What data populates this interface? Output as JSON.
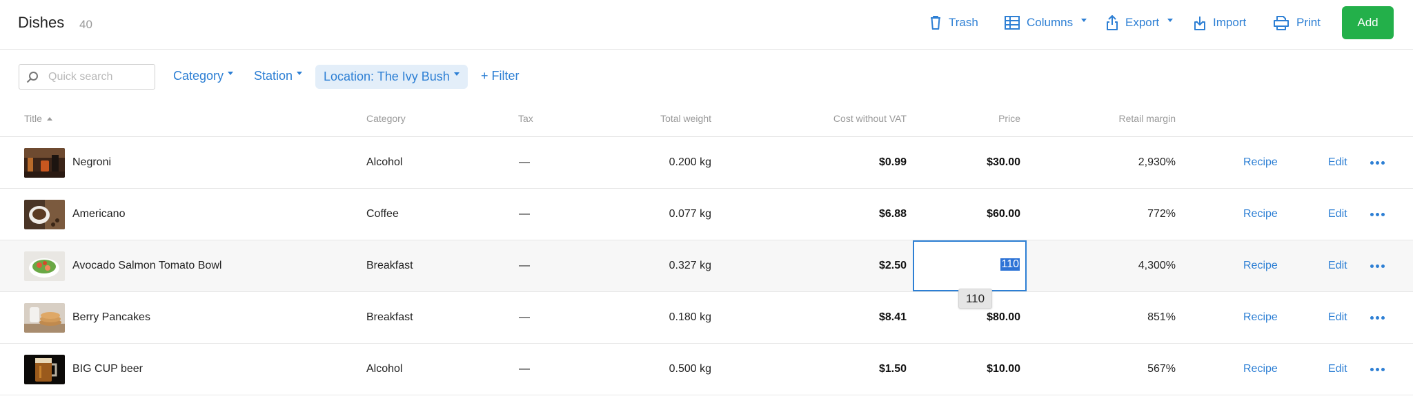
{
  "header": {
    "title": "Dishes",
    "count": "40",
    "toolbar": {
      "trash": "Trash",
      "columns": "Columns",
      "export": "Export",
      "import": "Import",
      "print": "Print",
      "add": "Add"
    }
  },
  "filters": {
    "search_placeholder": "Quick search",
    "category": "Category",
    "station": "Station",
    "location": "Location: The Ivy Bush",
    "add_filter": "+ Filter"
  },
  "table": {
    "columns": [
      "Title",
      "Category",
      "Tax",
      "Total weight",
      "Cost without VAT",
      "Price",
      "Retail margin"
    ],
    "sort_column": "Title",
    "rows": [
      {
        "title": "Negroni",
        "category": "Alcohol",
        "tax": "—",
        "weight": "0.200 kg",
        "cost": "$0.99",
        "price": "$30.00",
        "margin": "2,930%",
        "recipe": "Recipe",
        "edit": "Edit"
      },
      {
        "title": "Americano",
        "category": "Coffee",
        "tax": "—",
        "weight": "0.077 kg",
        "cost": "$6.88",
        "price": "$60.00",
        "margin": "772%",
        "recipe": "Recipe",
        "edit": "Edit"
      },
      {
        "title": "Avocado Salmon Tomato Bowl",
        "category": "Breakfast",
        "tax": "—",
        "weight": "0.327 kg",
        "cost": "$2.50",
        "price": "110",
        "margin": "4,300%",
        "recipe": "Recipe",
        "edit": "Edit"
      },
      {
        "title": "Berry Pancakes",
        "category": "Breakfast",
        "tax": "—",
        "weight": "0.180 kg",
        "cost": "$8.41",
        "price": "$80.00",
        "margin": "851%",
        "recipe": "Recipe",
        "edit": "Edit"
      },
      {
        "title": "BIG CUP beer",
        "category": "Alcohol",
        "tax": "—",
        "weight": "0.500 kg",
        "cost": "$1.50",
        "price": "$10.00",
        "margin": "567%",
        "recipe": "Recipe",
        "edit": "Edit"
      }
    ],
    "editing": {
      "value": "110",
      "tooltip": "110"
    }
  },
  "colors": {
    "accent": "#2d7fd4",
    "add_button": "#23b04a",
    "chip_bg": "#e3eef9"
  }
}
